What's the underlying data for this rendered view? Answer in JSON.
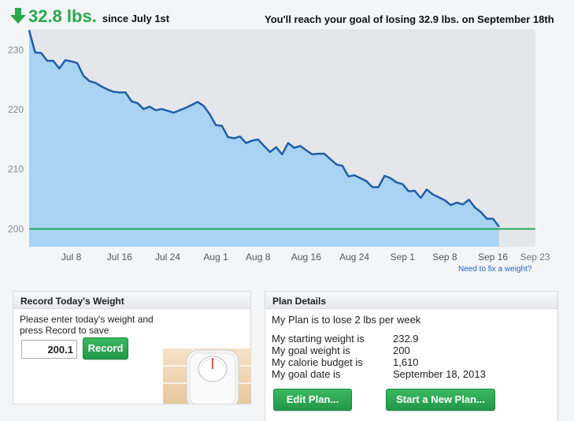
{
  "header": {
    "loss_value": "32.8 lbs.",
    "since_text": "since July 1st",
    "goal_message": "You'll reach your goal of losing 32.9 lbs. on September 18th"
  },
  "chart_data": {
    "type": "area",
    "x_tick_labels": [
      "Jul 8",
      "Jul 16",
      "Jul 24",
      "Aug 1",
      "Aug 8",
      "Aug 16",
      "Aug 24",
      "Sep 1",
      "Sep 8",
      "Sep 16",
      "Sep 23"
    ],
    "y_tick_labels": [
      "200",
      "210",
      "220",
      "230"
    ],
    "ylim": [
      197,
      233.5
    ],
    "goal_line": 200,
    "grid": false,
    "series": [
      {
        "values_start_date": "Jul 1",
        "weights": [
          233.3,
          229.6,
          229.5,
          228.2,
          228.2,
          226.9,
          228.3,
          228.1,
          227.8,
          225.7,
          224.8,
          224.5,
          223.9,
          223.4,
          223.0,
          222.9,
          222.9,
          221.4,
          221.1,
          220.1,
          220.5,
          219.9,
          220.1,
          219.8,
          219.5,
          219.9,
          220.3,
          220.8,
          221.3,
          220.6,
          219.2,
          217.4,
          217.3,
          215.4,
          215.2,
          215.5,
          214.4,
          214.8,
          215.0,
          213.9,
          212.9,
          213.7,
          212.5,
          214.4,
          213.6,
          213.9,
          213.2,
          212.5,
          212.6,
          212.6,
          211.7,
          210.8,
          210.6,
          208.8,
          209.0,
          208.5,
          208.0,
          207.0,
          207.0,
          208.9,
          208.5,
          207.8,
          207.5,
          206.3,
          206.4,
          205.2,
          206.6,
          205.8,
          205.3,
          204.8,
          204.0,
          204.4,
          204.1,
          204.9,
          203.6,
          202.8,
          201.7,
          201.7,
          200.4
        ]
      }
    ]
  },
  "link_fix_weight": "Need to fix a weight?",
  "record_panel": {
    "title": "Record Today's Weight",
    "instructions": "Please enter today's weight and press Record to save",
    "weight_value": "200.1",
    "button_label": "Record"
  },
  "plan_panel": {
    "title": "Plan Details",
    "plan_line": "My Plan is to lose 2 lbs per week",
    "rows": [
      {
        "label": "My starting weight is",
        "value": "232.9"
      },
      {
        "label": "My goal weight is",
        "value": "200"
      },
      {
        "label": "My calorie budget is",
        "value": "1,610"
      },
      {
        "label": "My goal date is",
        "value": "September 18, 2013"
      }
    ],
    "edit_label": "Edit Plan...",
    "new_plan_label": "Start a New Plan..."
  },
  "colors": {
    "accent_green": "#2aa84a",
    "area_fill": "#a9d3f3",
    "line": "#1f5faa",
    "goal_line": "#26a85e",
    "link": "#1e62c8"
  },
  "icons": [
    "down-arrow-icon",
    "scale-icon"
  ]
}
